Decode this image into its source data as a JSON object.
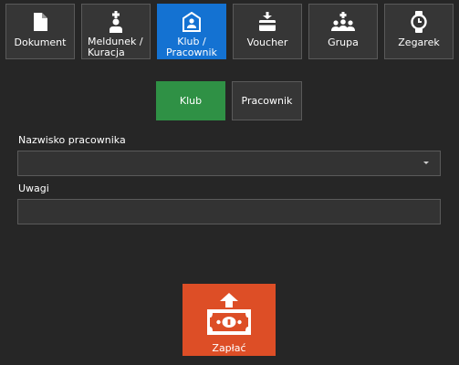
{
  "tabs": [
    {
      "label": "Dokument",
      "icon": "document-icon",
      "active": false
    },
    {
      "label_line1": "Meldunek /",
      "label_line2": "Kuracja",
      "icon": "person-plus-icon",
      "active": false
    },
    {
      "label_line1": "Klub /",
      "label_line2": "Pracownik",
      "icon": "person-badge-icon",
      "active": true
    },
    {
      "label": "Voucher",
      "icon": "voucher-card-icon",
      "active": false
    },
    {
      "label": "Grupa",
      "icon": "group-icon",
      "active": false
    },
    {
      "label": "Zegarek",
      "icon": "watch-icon",
      "active": false
    }
  ],
  "toggle": {
    "klub_label": "Klub",
    "pracownik_label": "Pracownik",
    "selected": "Klub"
  },
  "form": {
    "employee_name_label": "Nazwisko pracownika",
    "employee_name_value": "",
    "notes_label": "Uwagi",
    "notes_value": ""
  },
  "pay_button": {
    "label": "Zapłać",
    "icon": "banknote-up-icon"
  },
  "colors": {
    "background": "#262626",
    "tab": "#363636",
    "tab_active": "#1472d2",
    "toggle_active": "#2f9145",
    "pay": "#dd4e26",
    "border": "#5a5a5a"
  }
}
